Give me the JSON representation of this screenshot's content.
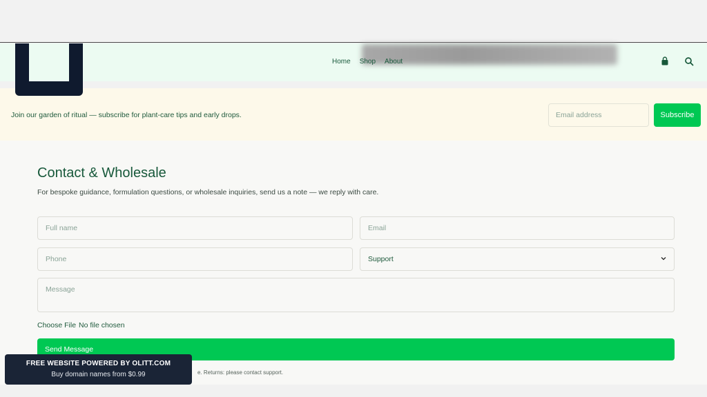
{
  "nav": {
    "items": [
      {
        "label": "Home"
      },
      {
        "label": "Shop"
      },
      {
        "label": "About"
      }
    ]
  },
  "icons": {
    "bag": "shopping-bag-icon",
    "search": "search-icon",
    "chevron": "chevron-down-icon"
  },
  "promo": {
    "text": "Join our garden of ritual — subscribe for plant-care tips and early drops.",
    "email_placeholder": "Email address",
    "subscribe_label": "Subscribe"
  },
  "contact": {
    "title": "Contact & Wholesale",
    "subtitle": "For bespoke guidance, formulation questions, or wholesale inquiries, send us a note — we reply with care.",
    "full_name_placeholder": "Full name",
    "email_placeholder": "Email",
    "phone_placeholder": "Phone",
    "topic_selected": "Support",
    "message_placeholder": "Message",
    "file_button": "Choose File",
    "file_status": "No file chosen",
    "send_label": "Send Message",
    "footnote": "e. Returns: please contact support."
  },
  "badge": {
    "title": "FREE WEBSITE POWERED BY OLITT.COM",
    "subtitle": "Buy domain names from $0.99"
  },
  "colors": {
    "accent": "#00c853",
    "brand_dark": "#0f1a2e",
    "text_green": "#17583a",
    "header_bg": "#ecfbf2",
    "promo_bg": "#fdf9ea"
  }
}
